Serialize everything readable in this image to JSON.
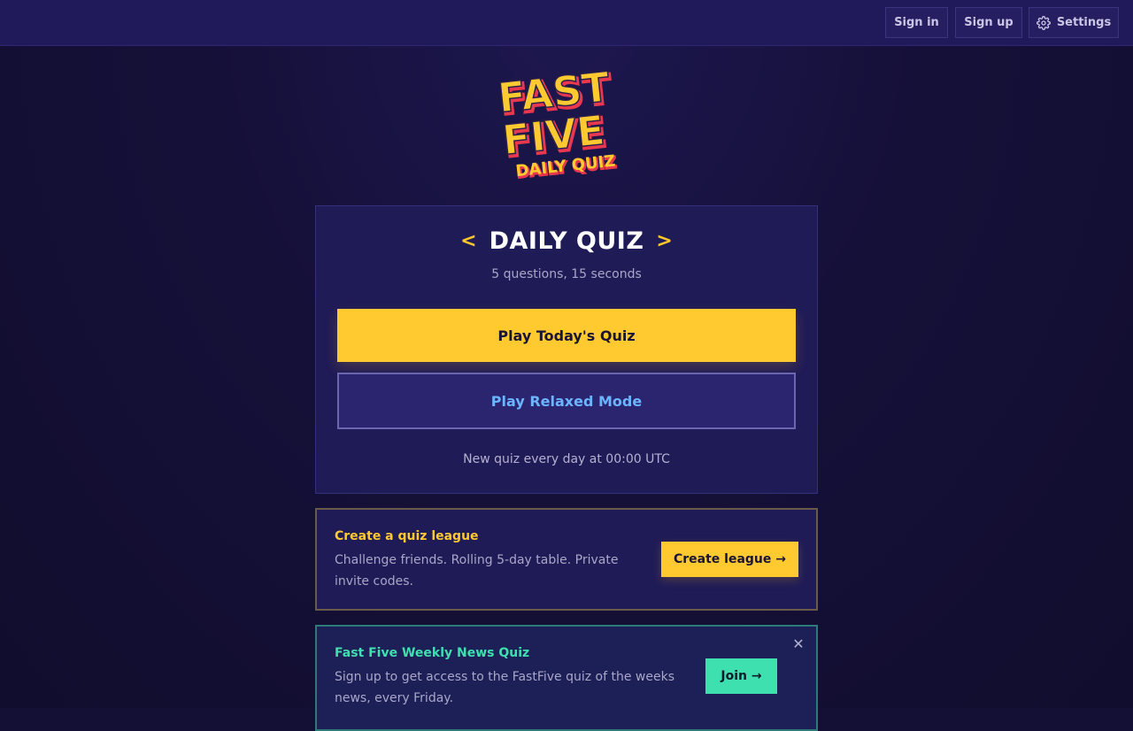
{
  "header": {
    "signin_label": "Sign in",
    "signup_label": "Sign up",
    "settings_label": "Settings",
    "settings_icon": "gear-icon"
  },
  "logo": {
    "line1": "FAST",
    "line2": "FIVE",
    "line3": "DAILY QUIZ"
  },
  "daily_card": {
    "chevron_left": "<",
    "chevron_right": ">",
    "title": "DAILY QUIZ",
    "subtitle": "5 questions, 15 seconds",
    "play_label": "Play Today's Quiz",
    "relaxed_label": "Play Relaxed Mode",
    "footer": "New quiz every day at 00:00 UTC"
  },
  "league_card": {
    "title": "Create a quiz league",
    "description": "Challenge friends. Rolling 5-day table. Private invite codes.",
    "button_label": "Create league →"
  },
  "news_card": {
    "title": "Fast Five Weekly News Quiz",
    "description": "Sign up to get access to the FastFive quiz of the weeks news, every Friday.",
    "button_label": "Join →",
    "close_glyph": "✕"
  },
  "colors": {
    "background": "#130f35",
    "topbar": "#201a5a",
    "accent_yellow": "#ffc930",
    "accent_blue": "#6cb4ff",
    "accent_green": "#3ee0b0",
    "logo_red": "#e8384f"
  }
}
